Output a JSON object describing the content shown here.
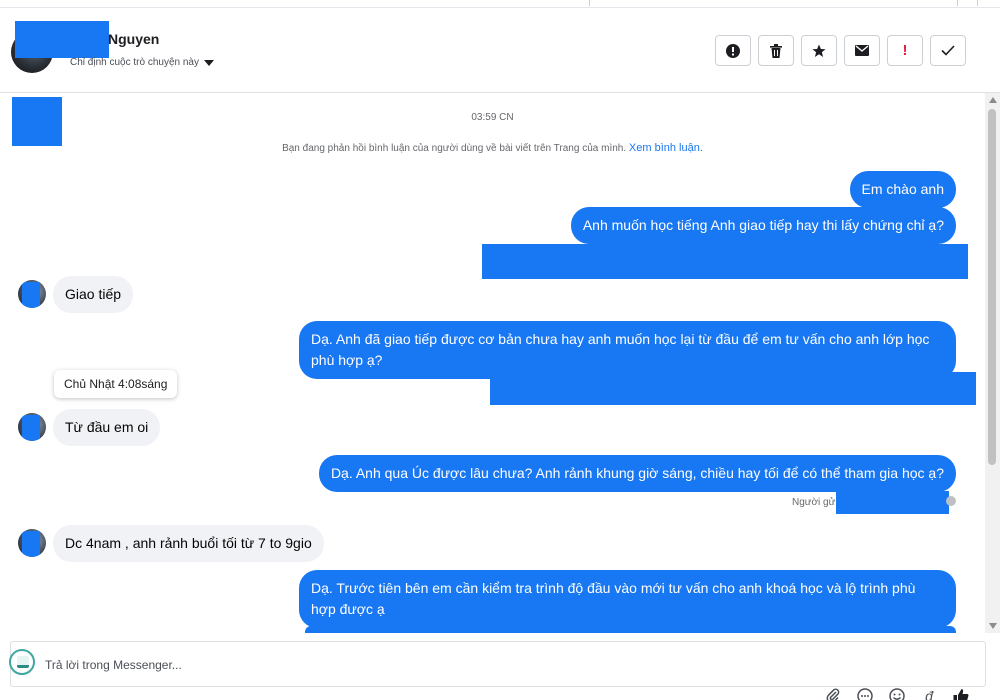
{
  "header": {
    "contact_name": "Nguyen",
    "assign_label": "Chỉ định cuộc trò chuyện này"
  },
  "actions": [
    {
      "name": "report-icon",
      "label": ""
    },
    {
      "name": "trash-icon",
      "label": ""
    },
    {
      "name": "star-icon",
      "label": ""
    },
    {
      "name": "envelope-icon",
      "label": ""
    },
    {
      "name": "important-icon",
      "label": "!"
    },
    {
      "name": "check-icon",
      "label": ""
    }
  ],
  "chat": {
    "timestamp": "03:59 CN",
    "notice_text": "Bạn đang phản hồi bình luận của người dùng về bài viết trên Trang của mình.",
    "notice_link": "Xem bình luận.",
    "tooltip": "Chủ Nhật 4:08sáng",
    "sent_by": "Người gử",
    "messages": [
      {
        "dir": "out",
        "text": "Em chào anh"
      },
      {
        "dir": "out",
        "text": "Anh muốn học tiếng Anh giao tiếp hay thi lấy chứng chỉ ạ?"
      },
      {
        "dir": "in",
        "text": "Giao tiếp"
      },
      {
        "dir": "out",
        "text": "Dạ. Anh đã giao tiếp được cơ bản chưa hay anh muốn học lại từ đầu để em tư vấn cho anh lớp học phù hợp ạ?"
      },
      {
        "dir": "in",
        "text": "Từ đầu em oi"
      },
      {
        "dir": "out",
        "text": "Dạ. Anh qua Úc được lâu chưa? Anh rảnh khung giờ sáng, chiều hay tối để có thể tham gia học ạ?"
      },
      {
        "dir": "in",
        "text": "Dc 4nam , anh rảnh buổi tối từ 7 to 9gio"
      },
      {
        "dir": "out",
        "text": "Dạ. Trước tiên bên em cần kiểm tra trình độ đầu vào mới tư vấn cho anh khoá học và lộ trình phù hợp được ạ"
      }
    ]
  },
  "reply": {
    "placeholder": "Trả lời trong Messenger..."
  },
  "tools": [
    {
      "name": "attachment-icon",
      "glyph": "⌀"
    },
    {
      "name": "saved-replies-icon",
      "glyph": "☺"
    },
    {
      "name": "emoji-icon",
      "glyph": "☺"
    },
    {
      "name": "currency-icon",
      "glyph": "đ"
    },
    {
      "name": "thumbs-up-icon",
      "glyph": "👍"
    }
  ],
  "colors": {
    "accent": "#1877f2",
    "incoming_bubble": "#f0f2f5"
  }
}
